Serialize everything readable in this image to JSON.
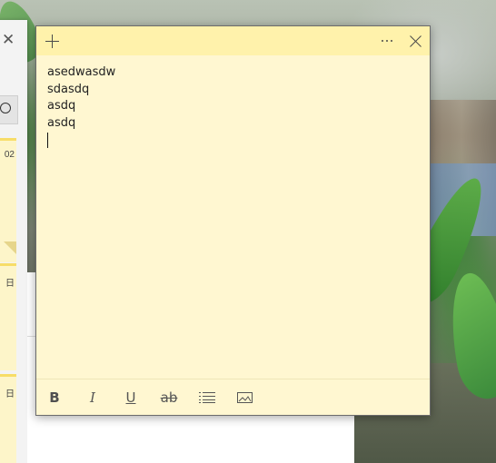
{
  "notes_list": {
    "mini_notes": [
      {
        "snippet": "02"
      },
      {
        "snippet": "日"
      },
      {
        "snippet": "日"
      }
    ]
  },
  "sticky_note": {
    "lines": [
      "asedwasdw",
      "sdasdq",
      "asdq",
      "asdq"
    ],
    "colors": {
      "header": "#fff2ab",
      "body": "#fff7d1"
    },
    "toolbar": {
      "bold": "B",
      "italic": "I",
      "underline": "U",
      "strikethrough": "ab"
    }
  },
  "icons": {
    "header": [
      "plus-icon",
      "more-options-icon",
      "close-icon"
    ],
    "toolbar": [
      "bold-icon",
      "italic-icon",
      "underline-icon",
      "strikethrough-icon",
      "bullet-list-icon",
      "image-icon"
    ],
    "list": [
      "close-icon",
      "search-icon"
    ]
  }
}
